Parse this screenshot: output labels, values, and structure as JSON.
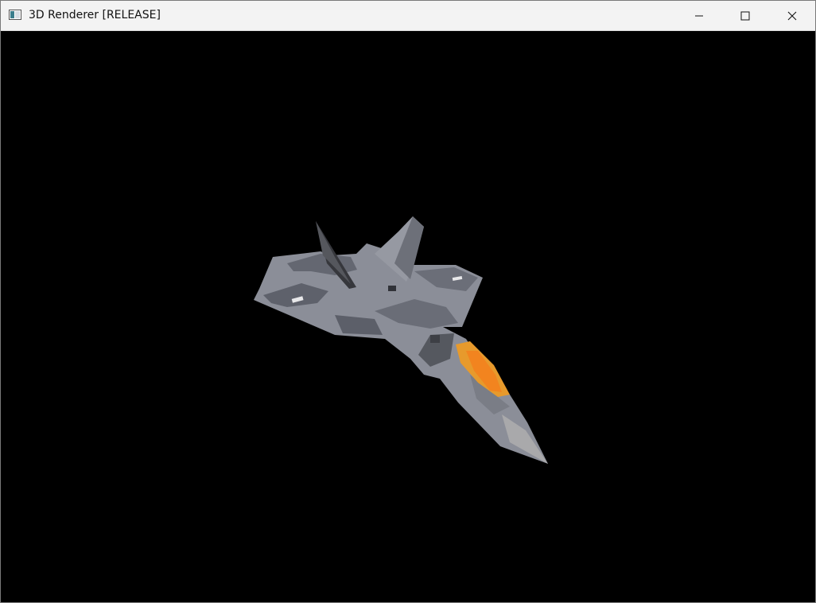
{
  "window": {
    "title": "3D Renderer [RELEASE]",
    "controls": [
      "minimize",
      "maximize",
      "close"
    ]
  },
  "viewport": {
    "background": "#000000",
    "model": "fighter-jet",
    "colors": {
      "body_light": "#8d8f99",
      "body_dark": "#5d5f69",
      "tail_dark": "#3a3b40",
      "nose": "#a8a8a8",
      "canopy_outer": "#e8a030",
      "canopy_inner": "#f08a30"
    }
  }
}
